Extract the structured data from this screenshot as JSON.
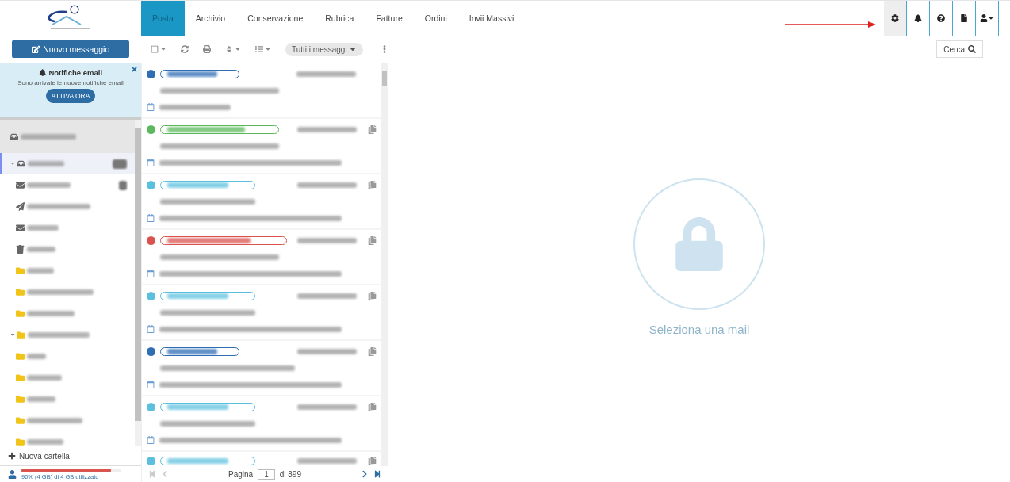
{
  "nav": {
    "tabs": [
      {
        "label": "Posta",
        "selected": true
      },
      {
        "label": "Archivio",
        "selected": false
      },
      {
        "label": "Conservazione",
        "selected": false
      },
      {
        "label": "Rubrica",
        "selected": false
      },
      {
        "label": "Fatture",
        "selected": false
      },
      {
        "label": "Ordini",
        "selected": false
      },
      {
        "label": "Invii Massivi",
        "selected": false
      }
    ],
    "tools": [
      {
        "kind": "settings",
        "selected": true
      },
      {
        "kind": "bell",
        "selected": false
      },
      {
        "kind": "help",
        "selected": false
      },
      {
        "kind": "file",
        "selected": false
      },
      {
        "kind": "user",
        "selected": false
      }
    ]
  },
  "toolbar": {
    "new_message": "Nuovo messaggio",
    "filter": "Tutti i messaggi",
    "search": "Cerca"
  },
  "notification": {
    "title": "Notifiche email",
    "text": "Sono arrivate le nuove notifiche email",
    "button": "ATTIVA ORA"
  },
  "folders": [
    {
      "kind": "account",
      "selected": false
    },
    {
      "kind": "inbox",
      "selected": true,
      "badge": true,
      "expanded": true,
      "children": [
        {
          "kind": "mail",
          "selected": false,
          "badge": true
        },
        {
          "kind": "sent",
          "selected": false
        },
        {
          "kind": "mail",
          "selected": false
        },
        {
          "kind": "trash",
          "selected": false
        },
        {
          "kind": "folder",
          "selected": false
        },
        {
          "kind": "folder",
          "selected": false
        },
        {
          "kind": "folder",
          "selected": false
        }
      ]
    },
    {
      "kind": "folder",
      "selected": false,
      "expanded": true,
      "children": [
        {
          "kind": "folder",
          "selected": false
        },
        {
          "kind": "folder",
          "selected": false
        },
        {
          "kind": "folder",
          "selected": false
        },
        {
          "kind": "folder",
          "selected": false
        },
        {
          "kind": "folder",
          "selected": false
        }
      ]
    }
  ],
  "new_folder": "Nuova cartella",
  "storage": {
    "level": 0.9,
    "text": "90% (4 GB) di 4 GB utilizzato"
  },
  "messages": [
    {
      "color": "#2f6db5",
      "attachment": false
    },
    {
      "color": "#5cb85c",
      "attachment": true
    },
    {
      "color": "#5bc0de",
      "attachment": true
    },
    {
      "color": "#d9534f",
      "attachment": true
    },
    {
      "color": "#5bc0de",
      "attachment": true
    },
    {
      "color": "#2f6db5",
      "attachment": true
    },
    {
      "color": "#5bc0de",
      "attachment": true
    },
    {
      "color": "#5bc0de",
      "attachment": true,
      "cut": true
    }
  ],
  "pager": {
    "label": "Pagina",
    "page": "1",
    "of": "di 899"
  },
  "empty": {
    "text": "Seleziona una mail"
  }
}
